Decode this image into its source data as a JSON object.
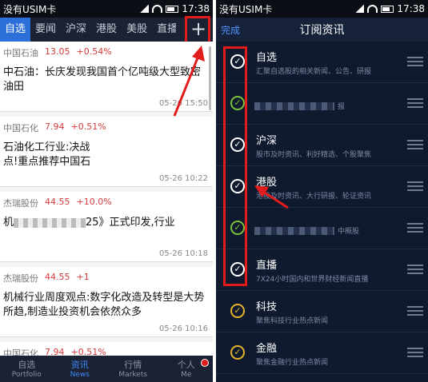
{
  "left": {
    "status": {
      "carrier": "没有USIM卡",
      "time": "17:38"
    },
    "tabs": [
      {
        "label": "自选",
        "active": true
      },
      {
        "label": "要闻"
      },
      {
        "label": "沪深"
      },
      {
        "label": "港股"
      },
      {
        "label": "美股"
      },
      {
        "label": "直播"
      }
    ],
    "plus_label": "+",
    "news": [
      {
        "stock": "中国石油",
        "price": "13.05",
        "change": "+0.54%",
        "headline": "中石油：长庆发现我国首个亿吨级大型致密油田",
        "date": "05-26 15:50"
      },
      {
        "stock": "中国石化",
        "price": "7.94",
        "change": "+0.51%",
        "headline": "石油化工行业:决战",
        "headline2": "点!重点推荐中国石",
        "date": "05-26 10:22"
      },
      {
        "stock": "杰瑞股份",
        "price": "44.55",
        "change": "+10.0%",
        "headline_pre": "机",
        "headline_post": "25》正式印发,行业",
        "date": "05-26 10:18"
      },
      {
        "stock": "杰瑞股份",
        "price": "44.55",
        "change": "+1",
        "headline": "机械行业周度观点:数字化改造及转型是大势所趋,制造业投资机会依然众多",
        "date": "05-26 10:16"
      },
      {
        "stock": "中国石化",
        "price": "7.94",
        "change": "+0.51%",
        "headline": "",
        "date": ""
      }
    ],
    "bottom_nav": [
      {
        "cn": "自选",
        "en": "Portfolio"
      },
      {
        "cn": "资讯",
        "en": "News",
        "active": true
      },
      {
        "cn": "行情",
        "en": "Markets"
      },
      {
        "cn": "个人",
        "en": "Me"
      }
    ]
  },
  "right": {
    "status": {
      "carrier": "没有USIM卡",
      "time": "17:38"
    },
    "done_label": "完成",
    "title": "订阅资讯",
    "subscriptions": [
      {
        "name": "自选",
        "desc": "汇聚自选股的相关新闻、公告、研报",
        "check": "white"
      },
      {
        "name": "",
        "desc": "报",
        "check": "green",
        "blurred": true
      },
      {
        "name": "沪深",
        "desc": "股市及时资讯、利好精选、个股聚焦",
        "check": "white"
      },
      {
        "name": "港股",
        "desc": "港股及时资讯、大行研报、轮证资讯",
        "check": "white"
      },
      {
        "name": "",
        "desc": "中概股",
        "check": "green",
        "blurred": true
      },
      {
        "name": "直播",
        "desc": "7X24小时国内和世界财经新闻直播",
        "check": "white"
      },
      {
        "name": "科技",
        "desc": "聚焦科技行业热点新闻",
        "check": "yellow"
      },
      {
        "name": "金融",
        "desc": "聚焦金融行业热点新闻",
        "check": "yellow"
      }
    ],
    "checkmark_glyph": "✓"
  },
  "colors": {
    "accent": "#2d6fd8",
    "highlight": "#e21b1b",
    "rise": "#d43a3a"
  }
}
